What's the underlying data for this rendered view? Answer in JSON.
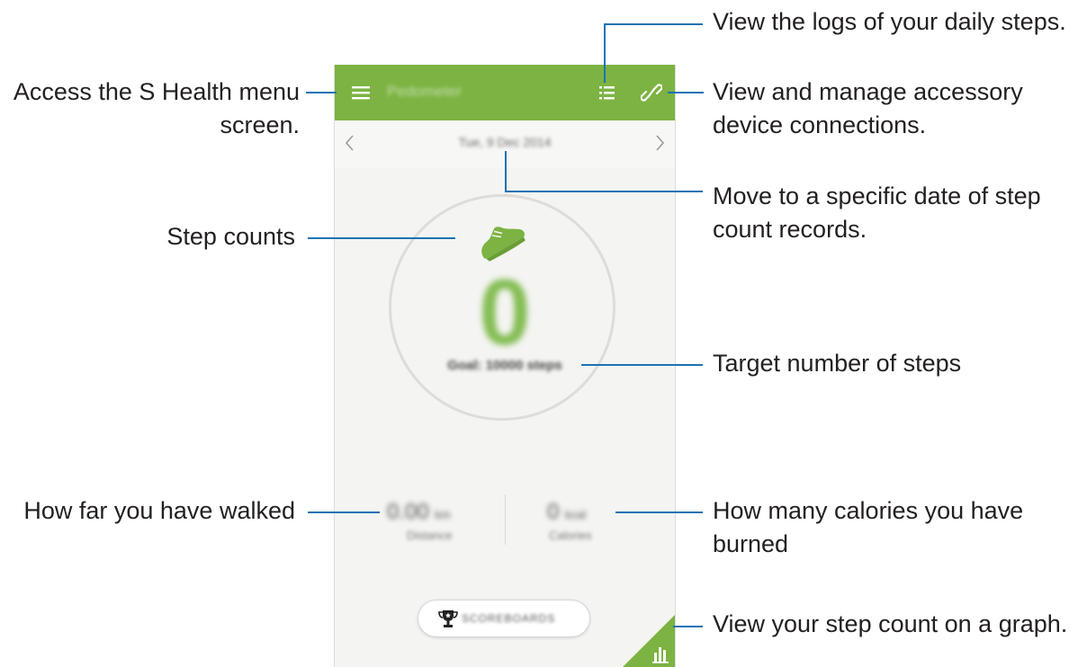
{
  "app": {
    "title": "Pedometer",
    "date": "Tue, 9 Dec 2014",
    "prev_date_glyph": "‹",
    "next_date_glyph": "›",
    "step_count": "0",
    "goal": "Goal: 10000 steps",
    "distance": {
      "value": "0.00",
      "unit": "km",
      "label": "Distance"
    },
    "calories": {
      "value": "0",
      "unit": "kcal",
      "label": "Calories"
    },
    "scoreboards_label": "SCOREBOARDS",
    "icons": [
      "menu-icon",
      "list-icon",
      "link-icon",
      "shoe-icon",
      "trophy-icon",
      "bar-chart-icon"
    ],
    "colors": {
      "accent": "#7cb342",
      "step_count": "#84bd54",
      "callout_line": "#1b73b3"
    }
  },
  "callouts": {
    "menu": [
      "Access the S Health menu",
      "screen."
    ],
    "logs": [
      "View the logs of your daily steps."
    ],
    "accessory": [
      "View and manage accessory",
      "device connections."
    ],
    "date": [
      "Move to a specific date of step",
      "count records."
    ],
    "steps": [
      "Step counts"
    ],
    "target": [
      "Target number of steps"
    ],
    "distance": [
      "How far you have walked"
    ],
    "calories": [
      "How many calories you have",
      "burned"
    ],
    "graph": [
      "View your step count on a graph."
    ]
  }
}
